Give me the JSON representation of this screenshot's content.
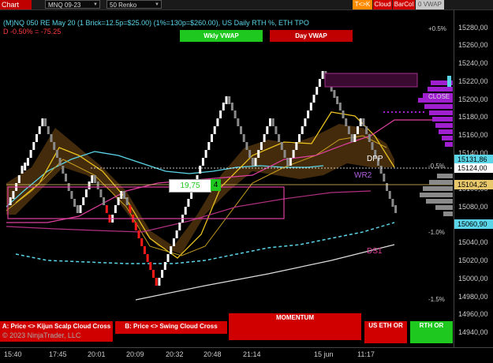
{
  "toolbar": {
    "chart_tab": "Chart",
    "instrument": "MNQ 09-23",
    "bar_type": "50 Renko",
    "toggle_label": "T<>K",
    "cloud_label": "Cloud",
    "barcol_label": "BarCol",
    "vwap_label": "0 VWAP"
  },
  "chart_title": {
    "line1": "(M)NQ 050 RE May 20 (1 Brick=12.5p=$25.00) (1%=130p=$260.00), US Daily RTH %, ETH TPO",
    "line2": "D -0.50% = -75.25"
  },
  "buttons": {
    "wkly_vwap": "Wkly VWAP",
    "day_vwap": "Day VWAP",
    "momentum": "MOMENTUM",
    "signal_a": "A: Price <> Kijun Scalp Cloud Cross",
    "signal_b": "B: Price <> Swing Cloud Cross",
    "us_eth_or": "US ETH OR",
    "rth_or": "RTH OR"
  },
  "copyright": "© 2023 NinjaTrader, LLC",
  "annotations": {
    "close": "CLOSE",
    "dpp": "DPP",
    "wr2": "WR2",
    "ds1": "DS1",
    "value_box": "19,75",
    "count_box": "4"
  },
  "percent_labels": [
    "+0.5%",
    "-0.5%",
    "-1.0%",
    "-1.5%"
  ],
  "price_axis": {
    "ticks": [
      "15280,00",
      "15260,00",
      "15240,00",
      "15220,00",
      "15200,00",
      "15180,00",
      "15160,00",
      "15140,00",
      "15100,00",
      "15080,00",
      "15040,00",
      "15020,00",
      "15000,00",
      "14980,00",
      "14960,00",
      "14940,00"
    ],
    "tags": [
      {
        "label": "15131,86",
        "color": "#5ad6e8",
        "text_color": "#000"
      },
      {
        "label": "15124,00",
        "color": "#ffffff",
        "text_color": "#000"
      },
      {
        "label": "15104,25",
        "color": "#e8c86a",
        "text_color": "#000"
      },
      {
        "label": "15060,90",
        "color": "#5ad6e8",
        "text_color": "#000"
      }
    ]
  },
  "time_axis": [
    "15:40",
    "17:45",
    "20:01",
    "20:09",
    "20:32",
    "20:48",
    "21:14",
    "15 jun",
    "11:17"
  ],
  "colors": {
    "bull": "#ffffff",
    "bear": "#ff1a1a",
    "neutral": "#8a8a8a",
    "cloud": "#5a3a10",
    "kijun": "#e8c020",
    "tenkan": "#5ad6e8",
    "profile": "#a020d0",
    "pink": "#e040a0",
    "green": "#20c020",
    "red": "#c00000"
  }
}
